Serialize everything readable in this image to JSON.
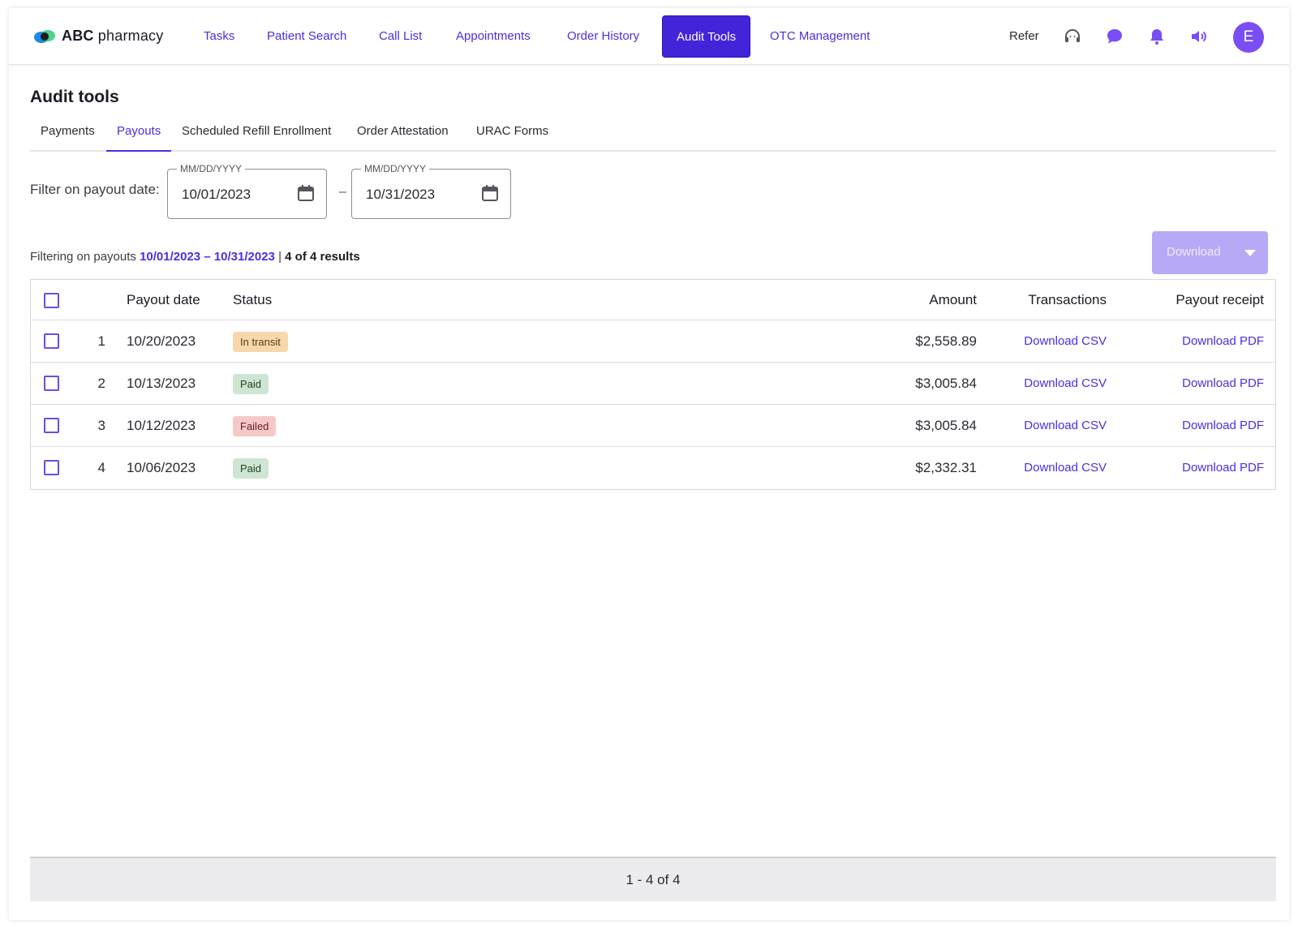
{
  "brand": {
    "name_bold": "ABC",
    "name_rest": " pharmacy"
  },
  "nav": {
    "items": [
      {
        "label": "Tasks"
      },
      {
        "label": "Patient Search"
      },
      {
        "label": "Call List"
      },
      {
        "label": "Appointments"
      },
      {
        "label": "Order History"
      },
      {
        "label": "Audit Tools",
        "active": true
      },
      {
        "label": "OTC Management"
      }
    ],
    "refer_label": "Refer",
    "icons": [
      "headset-icon",
      "chat-icon",
      "bell-icon",
      "speaker-icon"
    ],
    "avatar_initial": "E"
  },
  "page": {
    "title": "Audit tools",
    "tabs": [
      {
        "label": "Payments"
      },
      {
        "label": "Payouts",
        "active": true
      },
      {
        "label": "Scheduled Refill Enrollment"
      },
      {
        "label": "Order Attestation"
      },
      {
        "label": "URAC Forms"
      }
    ]
  },
  "filter": {
    "label": "Filter on payout date:",
    "start": {
      "legend": "MM/DD/YYYY",
      "value": "10/01/2023"
    },
    "separator": "–",
    "end": {
      "legend": "MM/DD/YYYY",
      "value": "10/31/2023"
    }
  },
  "summary": {
    "prefix": "Filtering on payouts ",
    "range": "10/01/2023 – 10/31/2023",
    "divider": " | ",
    "count": "4 of 4 results"
  },
  "download_button": {
    "label": "Download"
  },
  "table": {
    "columns": {
      "payout_date": "Payout date",
      "status": "Status",
      "amount": "Amount",
      "transactions": "Transactions",
      "receipt": "Payout receipt"
    },
    "rows": [
      {
        "index": "1",
        "date": "10/20/2023",
        "status": "In transit",
        "status_kind": "transit",
        "amount": "$2,558.89",
        "transactions": "Download CSV",
        "receipt": "Download PDF"
      },
      {
        "index": "2",
        "date": "10/13/2023",
        "status": "Paid",
        "status_kind": "paid",
        "amount": "$3,005.84",
        "transactions": "Download CSV",
        "receipt": "Download PDF"
      },
      {
        "index": "3",
        "date": "10/12/2023",
        "status": "Failed",
        "status_kind": "failed",
        "amount": "$3,005.84",
        "transactions": "Download CSV",
        "receipt": "Download PDF"
      },
      {
        "index": "4",
        "date": "10/06/2023",
        "status": "Paid",
        "status_kind": "paid",
        "amount": "$2,332.31",
        "transactions": "Download CSV",
        "receipt": "Download PDF"
      }
    ]
  },
  "pagination": {
    "text": "1 - 4 of 4"
  },
  "colors": {
    "accent": "#4a2fe0",
    "active_nav": "#4324d8",
    "avatar": "#7a4df5",
    "download_disabled": "#b8a9f7"
  }
}
